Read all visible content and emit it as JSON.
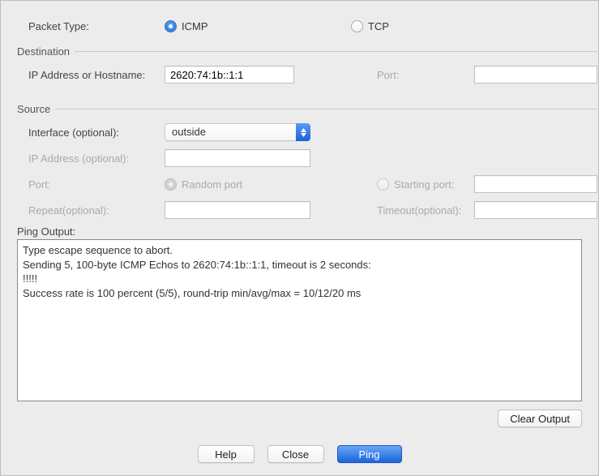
{
  "packetType": {
    "label": "Packet Type:",
    "icmp": "ICMP",
    "tcp": "TCP",
    "selected": "ICMP"
  },
  "destination": {
    "legend": "Destination",
    "ipLabel": "IP Address or Hostname:",
    "ipValue": "2620:74:1b::1:1",
    "portLabel": "Port:",
    "portValue": ""
  },
  "source": {
    "legend": "Source",
    "interfaceLabel": "Interface (optional):",
    "interfaceValue": "outside",
    "ipLabel": "IP Address (optional):",
    "ipValue": "",
    "portLabel": "Port:",
    "randomPort": "Random port",
    "startingPort": "Starting port:",
    "startingPortValue": "",
    "repeatLabel": "Repeat(optional):",
    "repeatValue": "",
    "timeoutLabel": "Timeout(optional):",
    "timeoutValue": ""
  },
  "output": {
    "label": "Ping Output:",
    "text": "Type escape sequence to abort.\nSending 5, 100-byte ICMP Echos to 2620:74:1b::1:1, timeout is 2 seconds:\n!!!!!\nSuccess rate is 100 percent (5/5), round-trip min/avg/max = 10/12/20 ms",
    "clear": "Clear Output"
  },
  "buttons": {
    "help": "Help",
    "close": "Close",
    "ping": "Ping"
  }
}
